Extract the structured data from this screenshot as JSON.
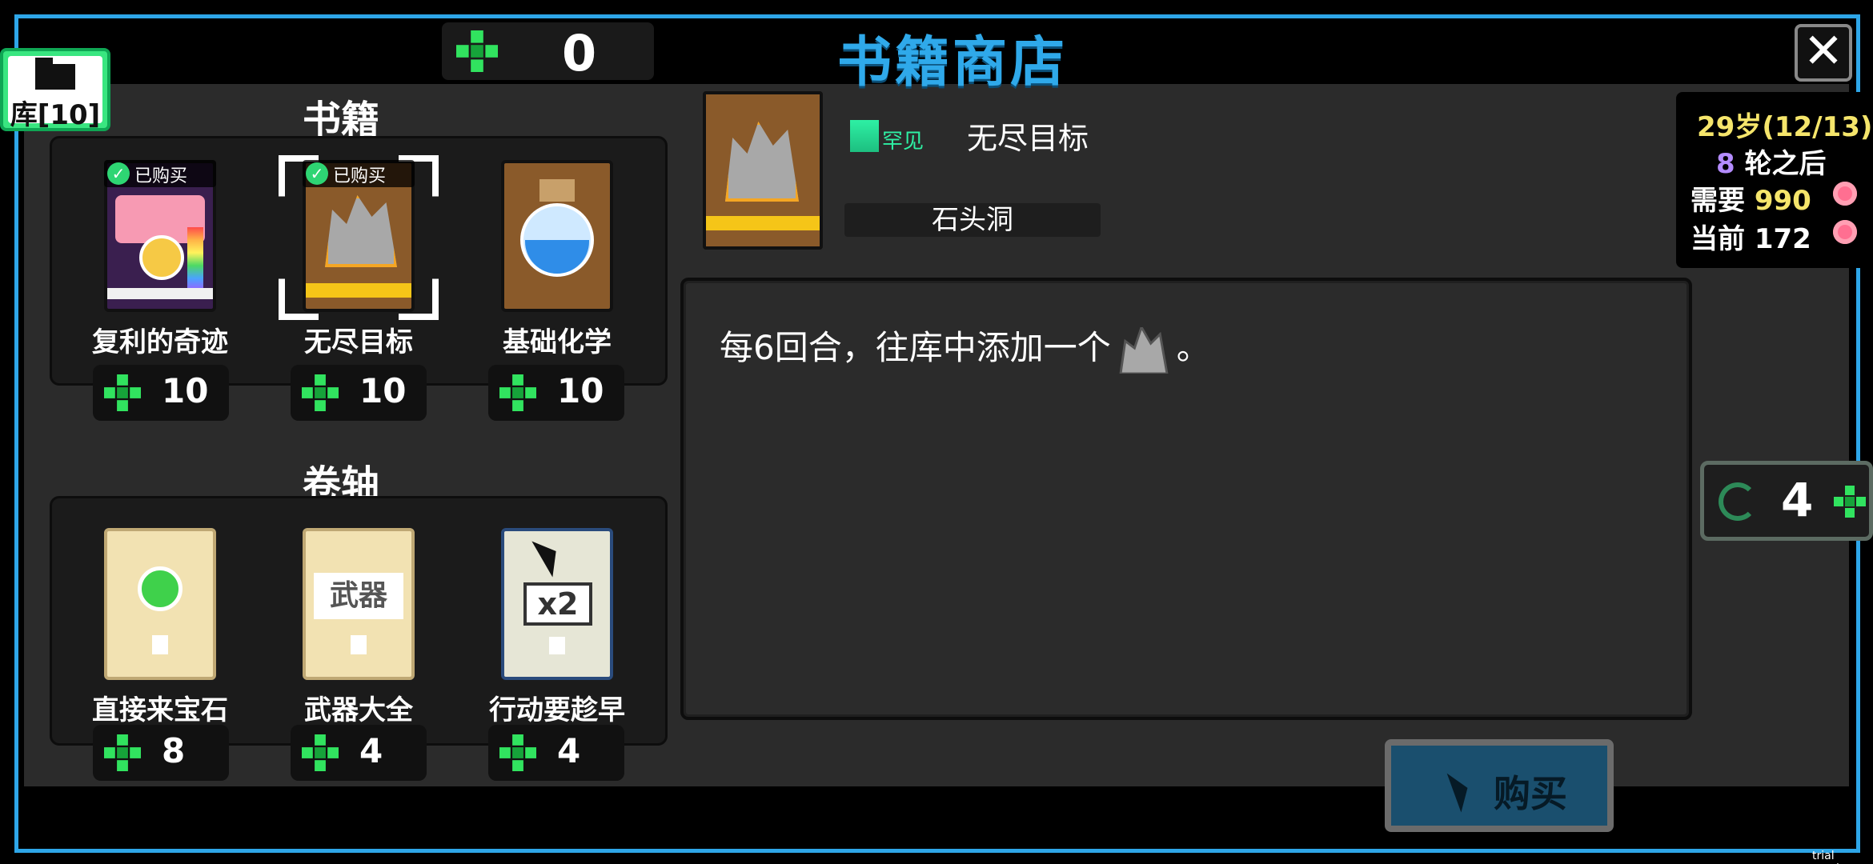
{
  "colors": {
    "accent": "#2ea6e8",
    "clover": "#31e35f",
    "rarity_rare": "#2ef0a4",
    "age": "#f5e56b",
    "rounds": "#b48cff"
  },
  "header": {
    "currency_value": "0",
    "title": "书籍商店",
    "close_icon": "close-icon"
  },
  "library": {
    "label": "库[10]"
  },
  "books": {
    "section_title": "书籍",
    "items": [
      {
        "name": "复利的奇迹",
        "price": "10",
        "bought": "已购买"
      },
      {
        "name": "无尽目标",
        "price": "10",
        "bought": "已购买"
      },
      {
        "name": "基础化学",
        "price": "10"
      }
    ]
  },
  "scrolls": {
    "section_title": "卷轴",
    "items": [
      {
        "name": "直接来宝石",
        "price": "8"
      },
      {
        "name": "武器大全",
        "price": "4",
        "scroll_text": "武器"
      },
      {
        "name": "行动要趁早",
        "price": "4",
        "scroll_text": "x2"
      }
    ]
  },
  "detail": {
    "rarity": "罕见",
    "name": "无尽目标",
    "tag": "石头洞",
    "description_prefix": "每6回合，往库中添加一个",
    "description_suffix": "。"
  },
  "stats": {
    "age": "29岁(12/13)",
    "rounds_num": "8",
    "rounds_text": "轮之后",
    "need_label": "需要",
    "need_value": "990",
    "current_label": "当前",
    "current_value": "172"
  },
  "reroll": {
    "cost": "4"
  },
  "buy": {
    "label": "购买"
  },
  "watermark": "trial version"
}
